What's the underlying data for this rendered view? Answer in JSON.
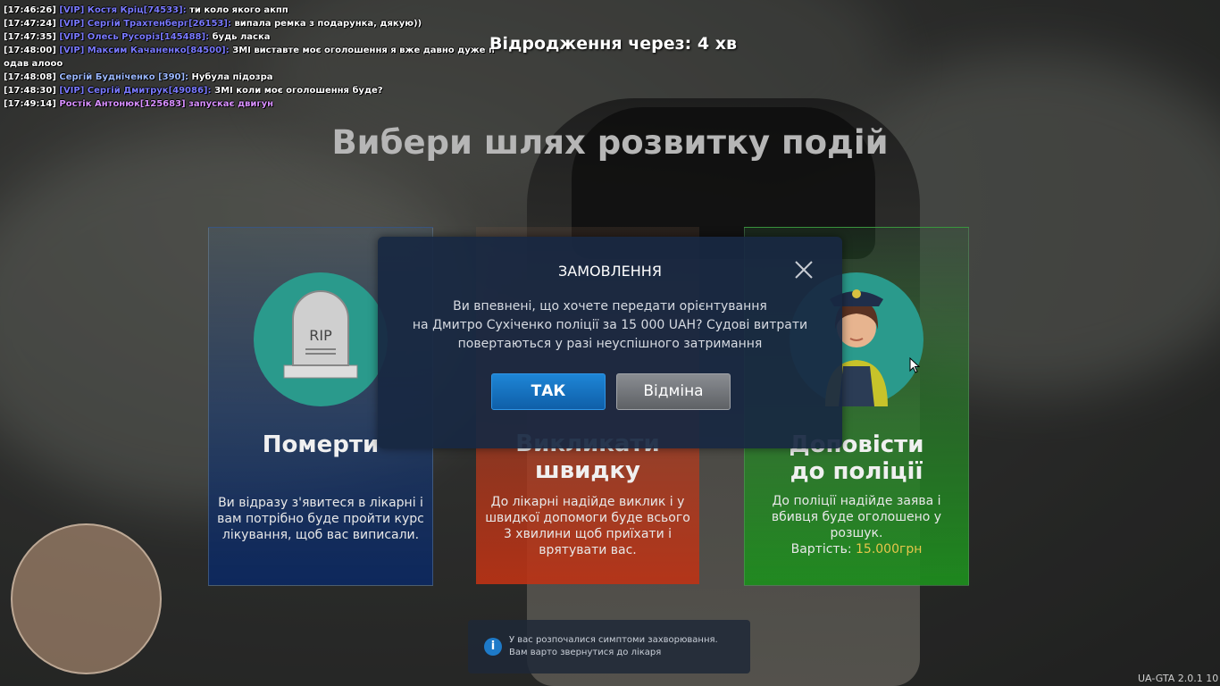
{
  "chat": [
    {
      "time": "[17:46:26]",
      "vip": "[VIP]",
      "name": "Костя Кріц[74533]:",
      "name_class": "vip",
      "msg": "ти коло якого акпп"
    },
    {
      "time": "[17:47:24]",
      "vip": "[VIP]",
      "name": "Сергій Трахтенберг[26153]:",
      "name_class": "vip",
      "msg": "випала ремка з подарунка, дякую))"
    },
    {
      "time": "[17:47:35]",
      "vip": "[VIP]",
      "name": "Олесь Русоріз[145488]:",
      "name_class": "vip",
      "msg": "будь ласка"
    },
    {
      "time": "[17:48:00]",
      "vip": "[VIP]",
      "name": "Максим Качаненко[84500]:",
      "name_class": "vip",
      "msg": "ЗМІ виставте моє оголошення я вже давно дуже п"
    },
    {
      "time": "",
      "vip": "",
      "name": "",
      "name_class": "",
      "msg": "одав алооо"
    },
    {
      "time": "[17:48:08]",
      "vip": "",
      "name": "Сергій Будніченко [390]:",
      "name_class": "name",
      "msg": "Нубула підозра"
    },
    {
      "time": "[17:48:30]",
      "vip": "[VIP]",
      "name": "Сергій Дмитрук[49086]:",
      "name_class": "vip",
      "msg": "ЗМІ коли моє оголошення буде?"
    },
    {
      "time": "[17:49:14]",
      "vip": "",
      "name": "Ростік Антонюк[125683] запускає двигун",
      "name_class": "pink",
      "msg": ""
    }
  ],
  "respawn": "Відродження через: 4  хв",
  "heading": "Вибери шлях розвитку подій",
  "cards": [
    {
      "title": "Померти",
      "desc": "Ви відразу з'явитеся в лікарні і вам потрібно буде пройти курс лікування, щоб вас виписали.",
      "icon": "tombstone-icon",
      "icon_text": "RIP"
    },
    {
      "title_line1": "Викликати",
      "title_line2": "швидку",
      "desc": "До лікарні надійде виклик і у швидкої допомоги буде всього 3 хвилини щоб приїхати і врятувати вас."
    },
    {
      "title_line1": "Доповісти",
      "title_line2": "до поліції",
      "desc": "До поліції надійде заява і вбивця буде оголошено у розшук.",
      "price_label": "Вартість:",
      "price_value": "15.000грн",
      "icon": "police-officer-icon"
    }
  ],
  "modal": {
    "title": "ЗАМОВЛЕННЯ",
    "line1": "Ви впевнені, що хочете передати орієнтування",
    "line2": "на Дмитро Сухіченко поліції за 15 000 UAH? Судові витрати",
    "line3": "повертаються у разі неуспішного затримання",
    "yes": "ТАК",
    "no": "Відміна"
  },
  "notification": {
    "line1": "У вас розпочалися симптоми захворювання.",
    "line2": "Вам варто звернутися до лікаря"
  },
  "version": "UA-GTA 2.0.1 10",
  "colors": {
    "accent": "#1e86d6",
    "card_blue": "#0c285f",
    "card_red": "#be3214",
    "card_green": "#1e8c1e",
    "price": "#e6c64a"
  }
}
